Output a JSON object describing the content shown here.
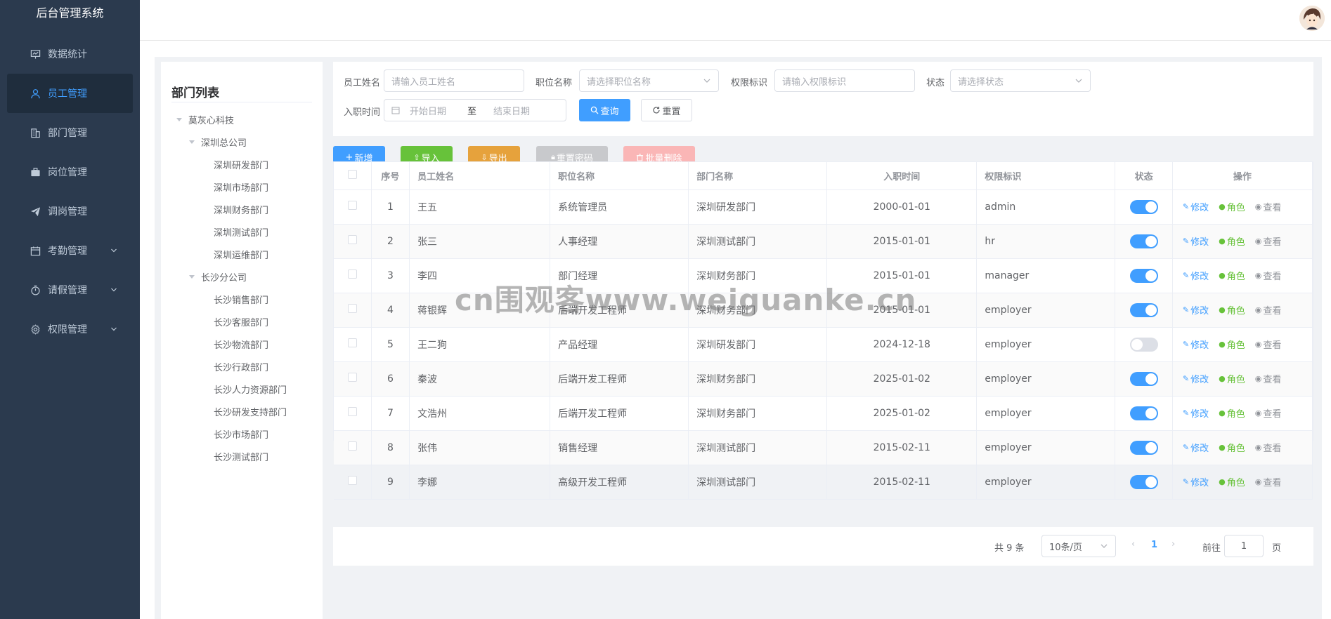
{
  "app": {
    "title": "后台管理系统"
  },
  "sidebar": {
    "items": [
      {
        "label": "数据统计"
      },
      {
        "label": "员工管理"
      },
      {
        "label": "部门管理"
      },
      {
        "label": "岗位管理"
      },
      {
        "label": "调岗管理"
      },
      {
        "label": "考勤管理"
      },
      {
        "label": "请假管理"
      },
      {
        "label": "权限管理"
      }
    ]
  },
  "tree": {
    "title": "部门列表",
    "root": "莫灰心科技",
    "groups": [
      {
        "label": "深圳总公司",
        "children": [
          "深圳研发部门",
          "深圳市场部门",
          "深圳财务部门",
          "深圳测试部门",
          "深圳运维部门"
        ]
      },
      {
        "label": "长沙分公司",
        "children": [
          "长沙销售部门",
          "长沙客服部门",
          "长沙物流部门",
          "长沙行政部门",
          "长沙人力资源部门",
          "长沙研发支持部门",
          "长沙市场部门",
          "长沙测试部门"
        ]
      }
    ]
  },
  "search": {
    "name_label": "员工姓名",
    "name_placeholder": "请输入员工姓名",
    "position_label": "职位名称",
    "position_placeholder": "请选择职位名称",
    "perm_label": "权限标识",
    "perm_placeholder": "请输入权限标识",
    "status_label": "状态",
    "status_placeholder": "请选择状态",
    "date_label": "入职时间",
    "start_placeholder": "开始日期",
    "range_sep": "至",
    "end_placeholder": "结束日期",
    "query_btn": "查询",
    "reset_btn": "重置"
  },
  "toolbar": {
    "add": "新增",
    "import": "导入",
    "export": "导出",
    "reset_pwd": "重置密码",
    "batch_delete": "批量删除"
  },
  "table": {
    "headers": [
      "序号",
      "员工姓名",
      "职位名称",
      "部门名称",
      "入职时间",
      "权限标识",
      "状态",
      "操作"
    ],
    "op_labels": {
      "edit": "修改",
      "role": "角色",
      "view": "查看"
    },
    "rows": [
      {
        "no": "1",
        "name": "王五",
        "position": "系统管理员",
        "dept": "深圳研发部门",
        "date": "2000-01-01",
        "perm": "admin",
        "status_on": true
      },
      {
        "no": "2",
        "name": "张三",
        "position": "人事经理",
        "dept": "深圳测试部门",
        "date": "2015-01-01",
        "perm": "hr",
        "status_on": true
      },
      {
        "no": "3",
        "name": "李四",
        "position": "部门经理",
        "dept": "深圳财务部门",
        "date": "2015-01-01",
        "perm": "manager",
        "status_on": true
      },
      {
        "no": "4",
        "name": "蒋银辉",
        "position": "后端开发工程师",
        "dept": "深圳财务部门",
        "date": "2015-01-01",
        "perm": "employer",
        "status_on": true
      },
      {
        "no": "5",
        "name": "王二狗",
        "position": "产品经理",
        "dept": "深圳研发部门",
        "date": "2024-12-18",
        "perm": "employer",
        "status_on": false
      },
      {
        "no": "6",
        "name": "秦波",
        "position": "后端开发工程师",
        "dept": "深圳财务部门",
        "date": "2025-01-02",
        "perm": "employer",
        "status_on": true
      },
      {
        "no": "7",
        "name": "文浩州",
        "position": "后端开发工程师",
        "dept": "深圳财务部门",
        "date": "2025-01-02",
        "perm": "employer",
        "status_on": true
      },
      {
        "no": "8",
        "name": "张伟",
        "position": "销售经理",
        "dept": "深圳测试部门",
        "date": "2015-02-11",
        "perm": "employer",
        "status_on": true
      },
      {
        "no": "9",
        "name": "李娜",
        "position": "高级开发工程师",
        "dept": "深圳测试部门",
        "date": "2015-02-11",
        "perm": "employer",
        "status_on": true
      }
    ]
  },
  "pagination": {
    "total_text": "共 9 条",
    "page_size": "10条/页",
    "current_page": "1",
    "goto_label": "前往",
    "goto_value": "1",
    "page_suffix": "页"
  },
  "watermark": "cn围观客www.weiguanke.cn",
  "colors": {
    "sidebar_bg": "#2b3a4e",
    "primary": "#409eff",
    "success": "#67c23a",
    "warning": "#e6a23c"
  }
}
